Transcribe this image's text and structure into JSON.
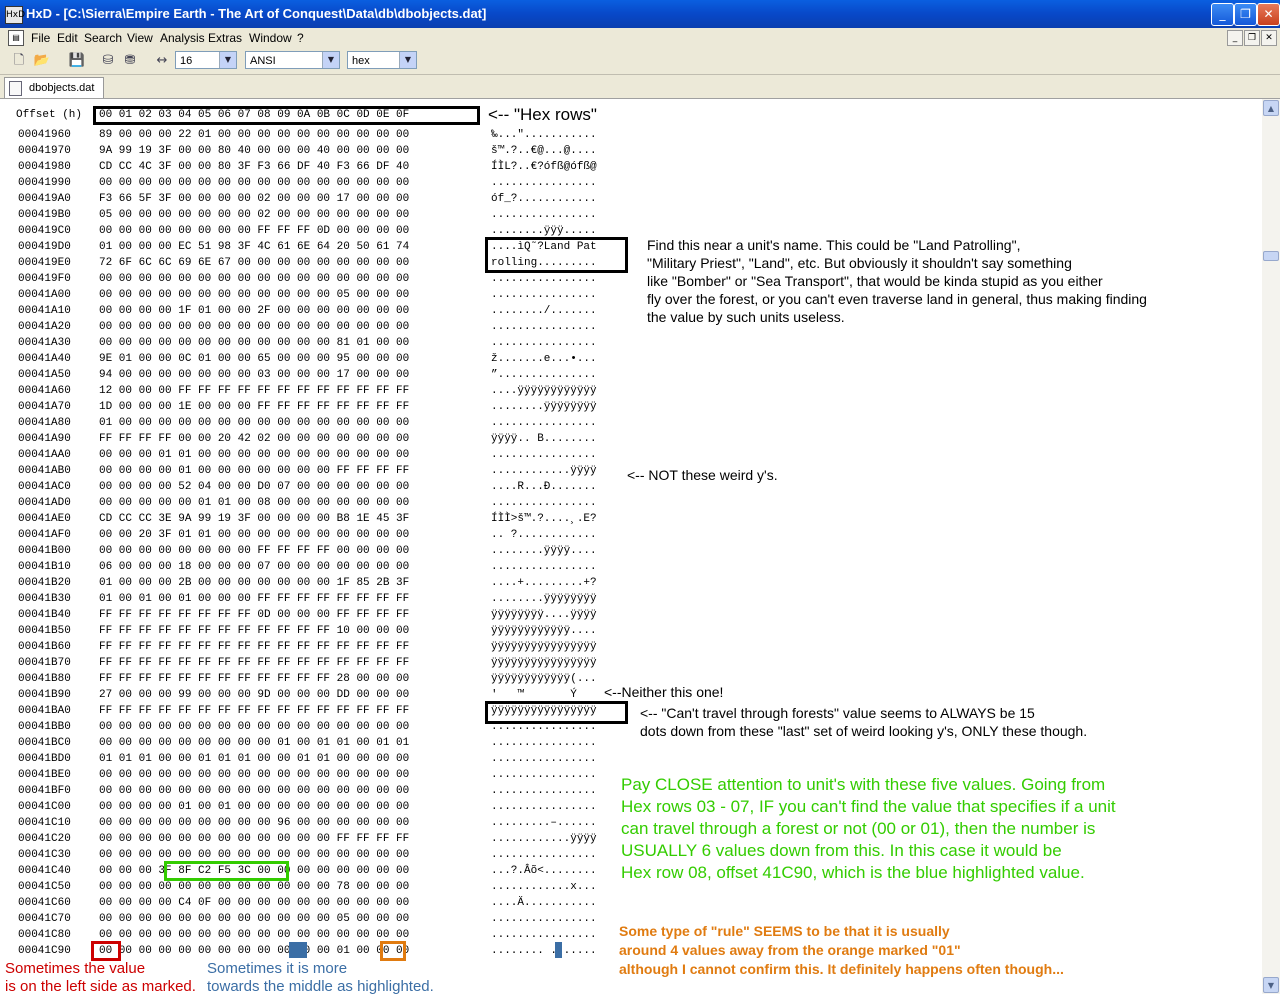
{
  "window": {
    "title": "HxD - [C:\\Sierra\\Empire Earth - The Art of Conquest\\Data\\db\\dbobjects.dat]",
    "app_icon": "HxD"
  },
  "menu": [
    "File",
    "Edit",
    "Search",
    "View",
    "Analysis",
    "Extras",
    "Window",
    "?"
  ],
  "toolbar": {
    "bytes_per_row": "16",
    "charset": "ANSI",
    "offset_base": "hex"
  },
  "tab": {
    "label": "dbobjects.dat"
  },
  "hex_header": {
    "offset_label": "Offset (h)",
    "columns": "00 01 02 03 04 05 06 07 08 09 0A 0B 0C 0D 0E 0F"
  },
  "rows": [
    [
      "00041960",
      "89 00 00 00 22 01 00 00 00 00 00 00 00 00 00 00",
      "‰...\"..........."
    ],
    [
      "00041970",
      "9A 99 19 3F 00 00 80 40 00 00 00 40 00 00 00 00",
      "š™.?..€@...@...."
    ],
    [
      "00041980",
      "CD CC 4C 3F 00 00 80 3F F3 66 DF 40 F3 66 DF 40",
      "ÍÌL?..€?ófß@ófß@"
    ],
    [
      "00041990",
      "00 00 00 00 00 00 00 00 00 00 00 00 00 00 00 00",
      "................"
    ],
    [
      "000419A0",
      "F3 66 5F 3F 00 00 00 00 02 00 00 00 17 00 00 00",
      "óf_?............"
    ],
    [
      "000419B0",
      "05 00 00 00 00 00 00 00 02 00 00 00 00 00 00 00",
      "................"
    ],
    [
      "000419C0",
      "00 00 00 00 00 00 00 00 FF FF FF 0D 00 00 00 00",
      "........ÿÿÿ....."
    ],
    [
      "000419D0",
      "01 00 00 00 EC 51 98 3F 4C 61 6E 64 20 50 61 74",
      "....ìQ˜?Land Pat"
    ],
    [
      "000419E0",
      "72 6F 6C 6C 69 6E 67 00 00 00 00 00 00 00 00 00",
      "rolling........."
    ],
    [
      "000419F0",
      "00 00 00 00 00 00 00 00 00 00 00 00 00 00 00 00",
      "................"
    ],
    [
      "00041A00",
      "00 00 00 00 00 00 00 00 00 00 00 00 05 00 00 00",
      "................"
    ],
    [
      "00041A10",
      "00 00 00 00 1F 01 00 00 2F 00 00 00 00 00 00 00",
      "......../......."
    ],
    [
      "00041A20",
      "00 00 00 00 00 00 00 00 00 00 00 00 00 00 00 00",
      "................"
    ],
    [
      "00041A30",
      "00 00 00 00 00 00 00 00 00 00 00 00 81 01 00 00",
      "................"
    ],
    [
      "00041A40",
      "9E 01 00 00 0C 01 00 00 65 00 00 00 95 00 00 00",
      "ž.......e...•..."
    ],
    [
      "00041A50",
      "94 00 00 00 00 00 00 00 03 00 00 00 17 00 00 00",
      "”..............."
    ],
    [
      "00041A60",
      "12 00 00 00 FF FF FF FF FF FF FF FF FF FF FF FF",
      "....ÿÿÿÿÿÿÿÿÿÿÿÿ"
    ],
    [
      "00041A70",
      "1D 00 00 00 1E 00 00 00 FF FF FF FF FF FF FF FF",
      "........ÿÿÿÿÿÿÿÿ"
    ],
    [
      "00041A80",
      "01 00 00 00 00 00 00 00 00 00 00 00 00 00 00 00",
      "................"
    ],
    [
      "00041A90",
      "FF FF FF FF 00 00 20 42 02 00 00 00 00 00 00 00",
      "ÿÿÿÿ.. B........"
    ],
    [
      "00041AA0",
      "00 00 00 01 01 00 00 00 00 00 00 00 00 00 00 00",
      "................"
    ],
    [
      "00041AB0",
      "00 00 00 00 01 00 00 00 00 00 00 00 FF FF FF FF",
      "............ÿÿÿÿ"
    ],
    [
      "00041AC0",
      "00 00 00 00 52 04 00 00 D0 07 00 00 00 00 00 00",
      "....R...Ð......."
    ],
    [
      "00041AD0",
      "00 00 00 00 00 01 01 00 08 00 00 00 00 00 00 00",
      "................"
    ],
    [
      "00041AE0",
      "CD CC CC 3E 9A 99 19 3F 00 00 00 00 B8 1E 45 3F",
      "ÍÌÌ>š™.?....¸.E?"
    ],
    [
      "00041AF0",
      "00 00 20 3F 01 01 00 00 00 00 00 00 00 00 00 00",
      ".. ?............"
    ],
    [
      "00041B00",
      "00 00 00 00 00 00 00 00 FF FF FF FF 00 00 00 00",
      "........ÿÿÿÿ...."
    ],
    [
      "00041B10",
      "06 00 00 00 18 00 00 00 07 00 00 00 00 00 00 00",
      "................"
    ],
    [
      "00041B20",
      "01 00 00 00 2B 00 00 00 00 00 00 00 1F 85 2B 3F",
      "....+.........+?"
    ],
    [
      "00041B30",
      "01 00 01 00 01 00 00 00 FF FF FF FF FF FF FF FF",
      "........ÿÿÿÿÿÿÿÿ"
    ],
    [
      "00041B40",
      "FF FF FF FF FF FF FF FF 0D 00 00 00 FF FF FF FF",
      "ÿÿÿÿÿÿÿÿ....ÿÿÿÿ"
    ],
    [
      "00041B50",
      "FF FF FF FF FF FF FF FF FF FF FF FF 10 00 00 00",
      "ÿÿÿÿÿÿÿÿÿÿÿÿ...."
    ],
    [
      "00041B60",
      "FF FF FF FF FF FF FF FF FF FF FF FF FF FF FF FF",
      "ÿÿÿÿÿÿÿÿÿÿÿÿÿÿÿÿ"
    ],
    [
      "00041B70",
      "FF FF FF FF FF FF FF FF FF FF FF FF FF FF FF FF",
      "ÿÿÿÿÿÿÿÿÿÿÿÿÿÿÿÿ"
    ],
    [
      "00041B80",
      "FF FF FF FF FF FF FF FF FF FF FF FF 28 00 00 00",
      "ÿÿÿÿÿÿÿÿÿÿÿÿ(..."
    ],
    [
      "00041B90",
      "27 00 00 00 99 00 00 00 9D 00 00 00 DD 00 00 00",
      "'   ™       Ý   "
    ],
    [
      "00041BA0",
      "FF FF FF FF FF FF FF FF FF FF FF FF FF FF FF FF",
      "ÿÿÿÿÿÿÿÿÿÿÿÿÿÿÿÿ"
    ],
    [
      "00041BB0",
      "00 00 00 00 00 00 00 00 00 00 00 00 00 00 00 00",
      "................"
    ],
    [
      "00041BC0",
      "00 00 00 00 00 00 00 00 00 01 00 01 01 00 01 01",
      "................"
    ],
    [
      "00041BD0",
      "01 01 01 00 00 01 01 01 00 00 01 01 00 00 00 00",
      "................"
    ],
    [
      "00041BE0",
      "00 00 00 00 00 00 00 00 00 00 00 00 00 00 00 00",
      "................"
    ],
    [
      "00041BF0",
      "00 00 00 00 00 00 00 00 00 00 00 00 00 00 00 00",
      "................"
    ],
    [
      "00041C00",
      "00 00 00 00 01 00 01 00 00 00 00 00 00 00 00 00",
      "................"
    ],
    [
      "00041C10",
      "00 00 00 00 00 00 00 00 00 96 00 00 00 00 00 00",
      ".........–......"
    ],
    [
      "00041C20",
      "00 00 00 00 00 00 00 00 00 00 00 00 FF FF FF FF",
      "............ÿÿÿÿ"
    ],
    [
      "00041C30",
      "00 00 00 00 00 00 00 00 00 00 00 00 00 00 00 00",
      "................"
    ],
    [
      "00041C40",
      "00 00 00 3F 8F C2 F5 3C 00 00 00 00 00 00 00 00",
      "...?.Âõ<........"
    ],
    [
      "00041C50",
      "00 00 00 00 00 00 00 00 00 00 00 00 78 00 00 00",
      "............x..."
    ],
    [
      "00041C60",
      "00 00 00 00 C4 0F 00 00 00 00 00 00 00 00 00 00",
      "....Ä..........."
    ],
    [
      "00041C70",
      "00 00 00 00 00 00 00 00 00 00 00 00 05 00 00 00",
      "................"
    ],
    [
      "00041C80",
      "00 00 00 00 00 00 00 00 00 00 00 00 00 00 00 00",
      "................"
    ],
    [
      "00041C90",
      "00 00 00 00 00 00 00 00 00 00 00 00 01 00 00 00",
      "........ . ....."
    ]
  ],
  "annotations": {
    "hex_rows": "<-- \"Hex rows\"",
    "land_note": "Find this near a unit's name. This could be \"Land Patrolling\",\n\"Military Priest\", \"Land\", etc. But obviously it shouldn't say something\nlike \"Bomber\" or \"Sea Transport\", that would be kinda stupid as you either\nfly over the forest, or you can't even traverse land in general, thus making finding\nthe value by such units useless.",
    "not_weird": "<-- NOT these weird y's.",
    "neither": "<--Neither this one!",
    "cant_travel": "<-- \"Can't travel through forests\" value seems to ALWAYS be 15\ndots down from these \"last\" set of weird looking y's, ONLY these though.",
    "green_note": "Pay CLOSE attention to unit's with these five values. Going from\nHex rows 03 - 07, IF you can't find the value that specifies if a unit\ncan travel through a forest or not (00 or 01), then the number is\nUSUALLY 6 values down from this. In this case it would be\nHex row 08, offset 41C90, which is the blue highlighted value.",
    "orange_note": "Some type of \"rule\" SEEMS to be that it is usually\naround 4 values away from the orange marked \"01\"\nalthough I cannot confirm this. It definitely happens often though...",
    "red_note": "Sometimes the value\nis on the left side as marked.",
    "blue_note": "Sometimes it is more\ntowards the middle as highlighted."
  },
  "colors": {
    "green": "#33cc00",
    "orange": "#e07b10",
    "red": "#cc0000",
    "blue": "#3b6ea5",
    "title_blue": "#0a52d8"
  }
}
